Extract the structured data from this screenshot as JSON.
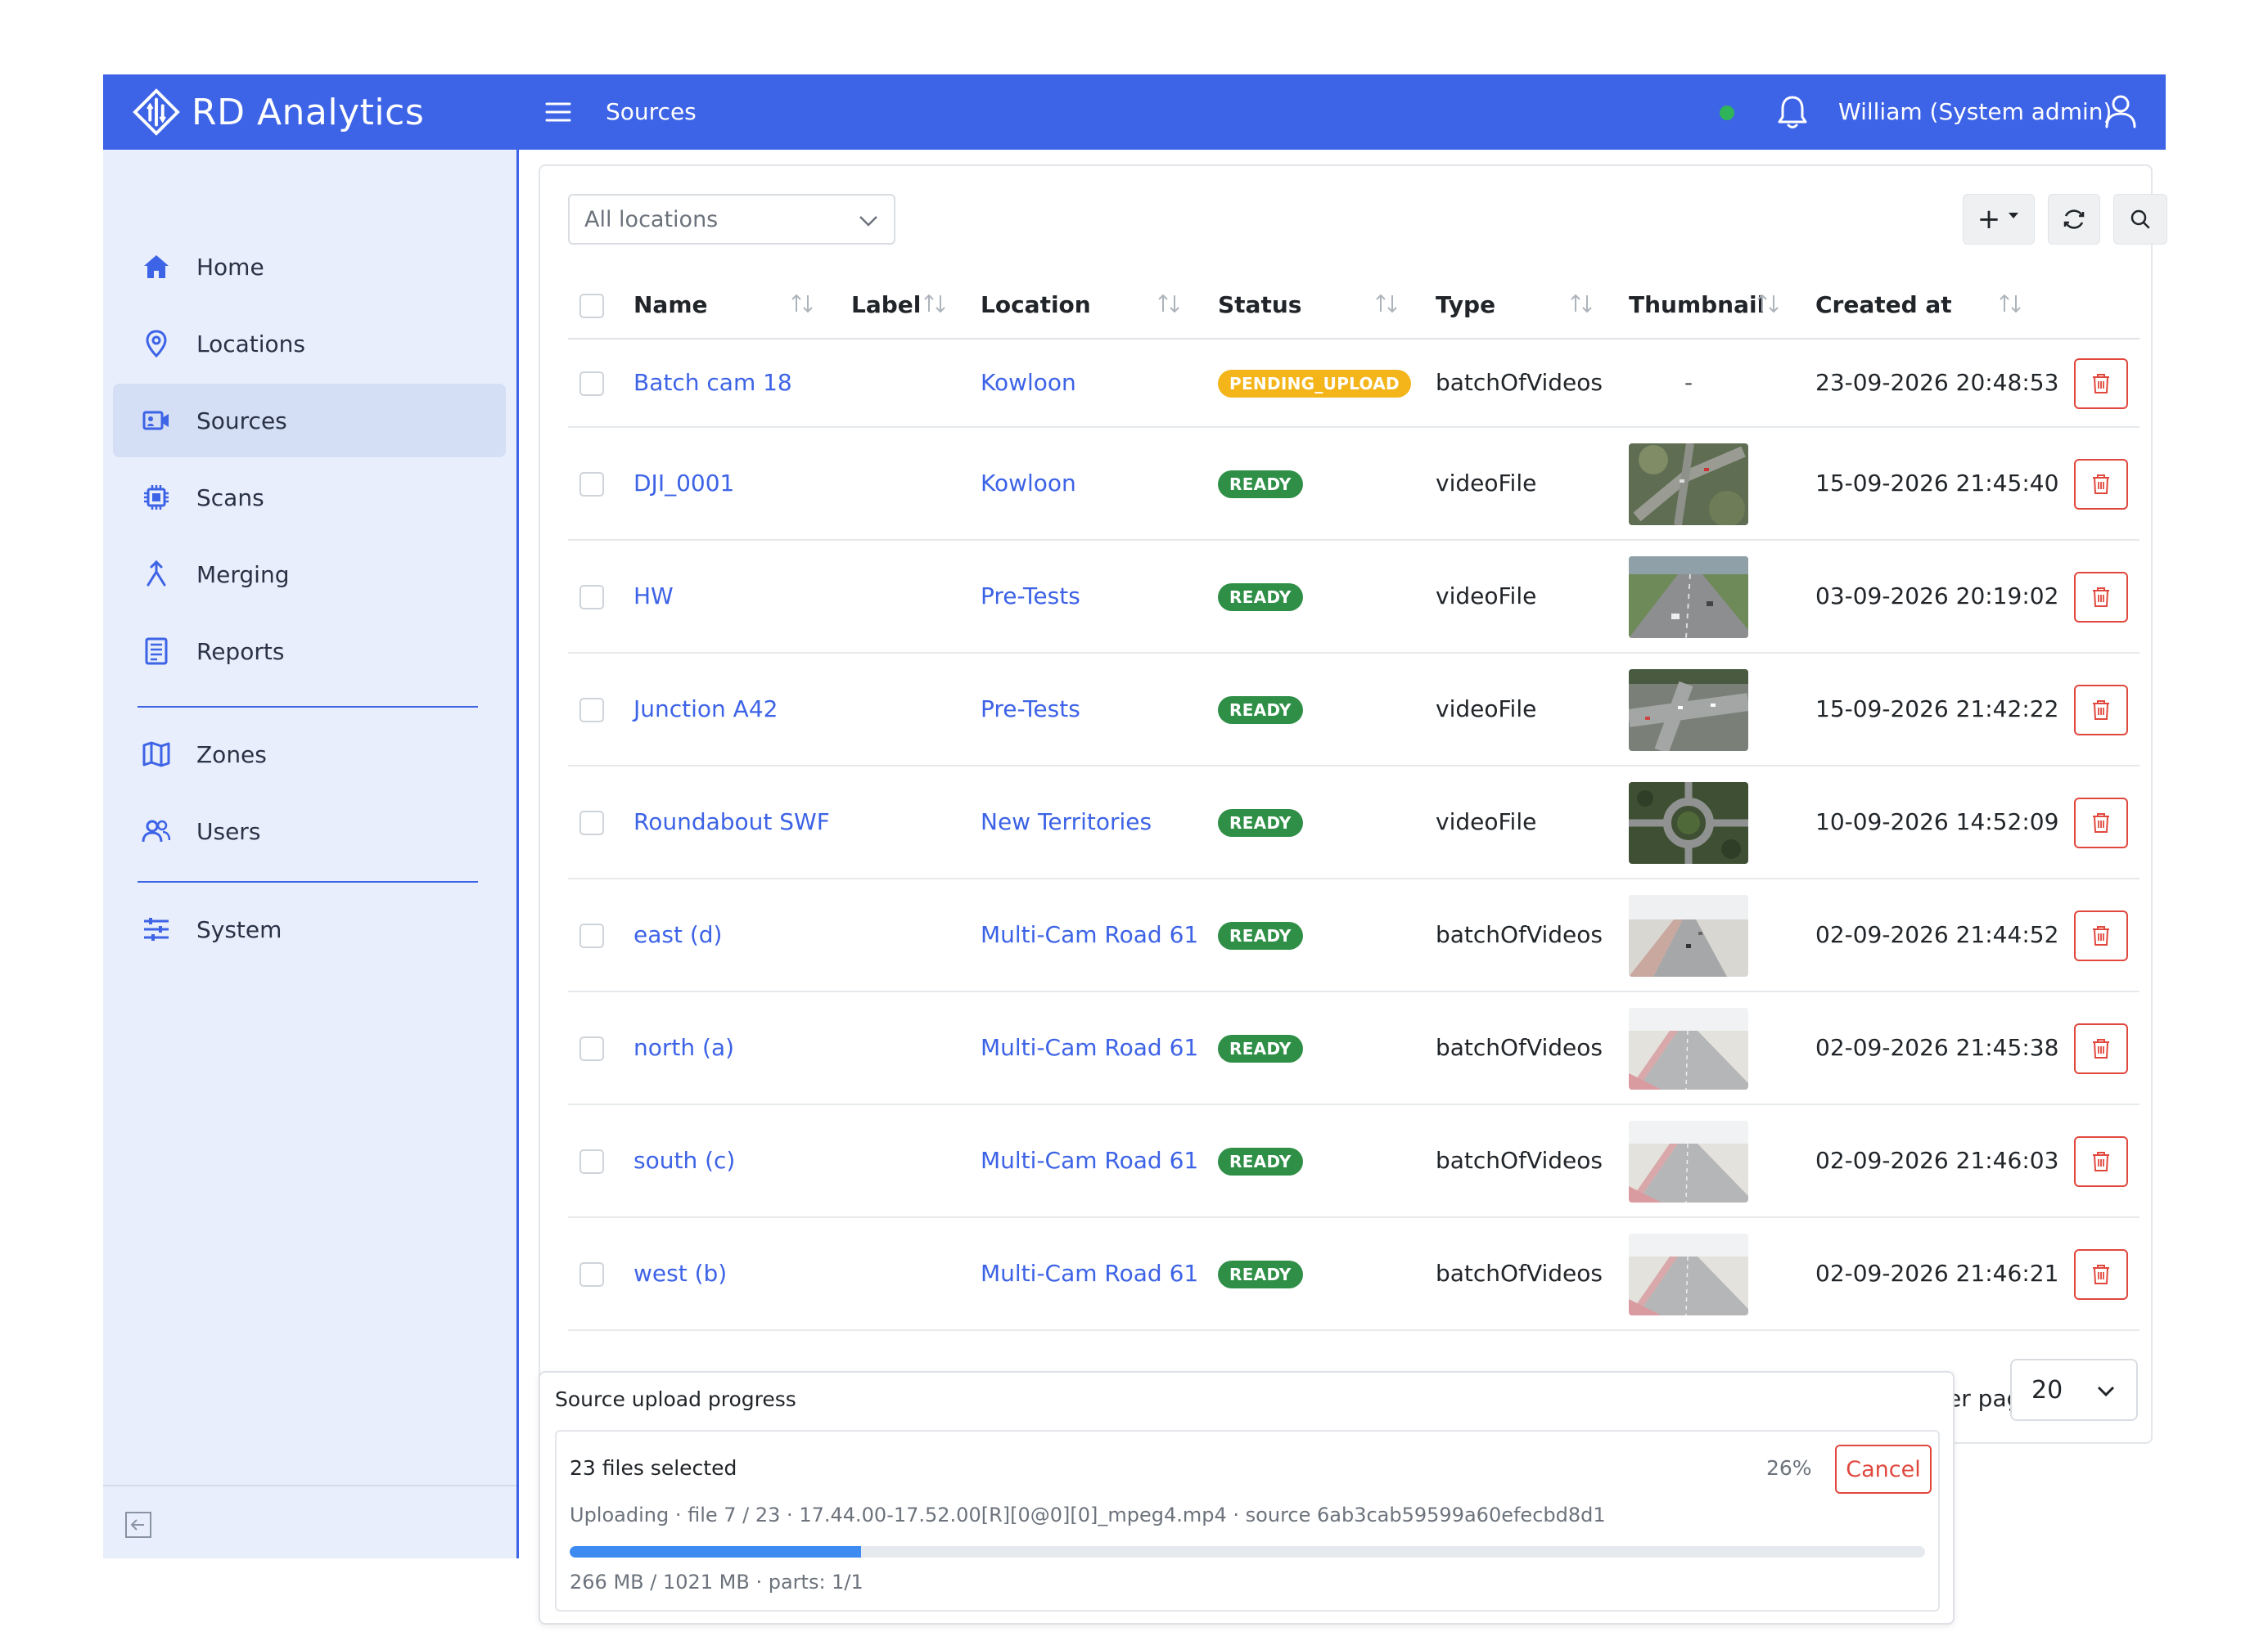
{
  "header": {
    "brand": "RD Analytics",
    "page_title": "Sources",
    "user": "William (System admin)",
    "status_color": "#2fb45a"
  },
  "sidebar": {
    "items": [
      {
        "label": "Home",
        "icon": "home-icon"
      },
      {
        "label": "Locations",
        "icon": "map-pin-icon"
      },
      {
        "label": "Sources",
        "icon": "video-camera-icon",
        "active": true
      },
      {
        "label": "Scans",
        "icon": "chip-icon"
      },
      {
        "label": "Merging",
        "icon": "merge-icon"
      },
      {
        "label": "Reports",
        "icon": "report-icon"
      },
      {
        "label": "Zones",
        "icon": "map-icon"
      },
      {
        "label": "Users",
        "icon": "users-icon"
      },
      {
        "label": "System",
        "icon": "sliders-icon"
      }
    ]
  },
  "filters": {
    "location_select": "All locations"
  },
  "toolbar": {
    "add_label": "+"
  },
  "table": {
    "columns": [
      "Name",
      "Label",
      "Location",
      "Status",
      "Type",
      "Thumbnail",
      "Created at"
    ],
    "rows": [
      {
        "name": "Batch cam 18",
        "label": "",
        "location": "Kowloon",
        "status": "PENDING_UPLOAD",
        "type": "batchOfVideos",
        "thumbnail": "-",
        "created": "23-09-2026 20:48:53",
        "thumb_style": "none"
      },
      {
        "name": "DJI_0001",
        "label": "",
        "location": "Kowloon",
        "status": "READY",
        "type": "videoFile",
        "thumbnail": "",
        "created": "15-09-2026 21:45:40",
        "thumb_style": "aerial"
      },
      {
        "name": "HW",
        "label": "",
        "location": "Pre-Tests",
        "status": "READY",
        "type": "videoFile",
        "thumbnail": "",
        "created": "03-09-2026 20:19:02",
        "thumb_style": "highway"
      },
      {
        "name": "Junction A42",
        "label": "",
        "location": "Pre-Tests",
        "status": "READY",
        "type": "videoFile",
        "thumbnail": "",
        "created": "15-09-2026 21:42:22",
        "thumb_style": "junction"
      },
      {
        "name": "Roundabout SWF",
        "label": "",
        "location": "New Territories",
        "status": "READY",
        "type": "videoFile",
        "thumbnail": "",
        "created": "10-09-2026 14:52:09",
        "thumb_style": "roundabout"
      },
      {
        "name": "east (d)",
        "label": "",
        "location": "Multi-Cam Road 61",
        "status": "READY",
        "type": "batchOfVideos",
        "thumbnail": "",
        "created": "02-09-2026 21:44:52",
        "thumb_style": "road"
      },
      {
        "name": "north (a)",
        "label": "",
        "location": "Multi-Cam Road 61",
        "status": "READY",
        "type": "batchOfVideos",
        "thumbnail": "",
        "created": "02-09-2026 21:45:38",
        "thumb_style": "road-pink"
      },
      {
        "name": "south (c)",
        "label": "",
        "location": "Multi-Cam Road 61",
        "status": "READY",
        "type": "batchOfVideos",
        "thumbnail": "",
        "created": "02-09-2026 21:46:03",
        "thumb_style": "road-pink"
      },
      {
        "name": "west (b)",
        "label": "",
        "location": "Multi-Cam Road 61",
        "status": "READY",
        "type": "batchOfVideos",
        "thumbnail": "",
        "created": "02-09-2026 21:46:21",
        "thumb_style": "road-pink"
      }
    ]
  },
  "pagination": {
    "per_page_label": "ıs per page:",
    "per_page_value": "20"
  },
  "upload": {
    "title": "Source upload progress",
    "files_selected": "23 files selected",
    "percent_label": "26%",
    "progress": 0.215,
    "cancel_label": "Cancel",
    "status_line": "Uploading · file 7 / 23 · 17.44.00-17.52.00[R][0@0][0]_mpeg4.mp4 · source 6ab3cab59599a60efecbd8d1",
    "size_line": "266 MB / 1021 MB · parts: 1/1"
  }
}
